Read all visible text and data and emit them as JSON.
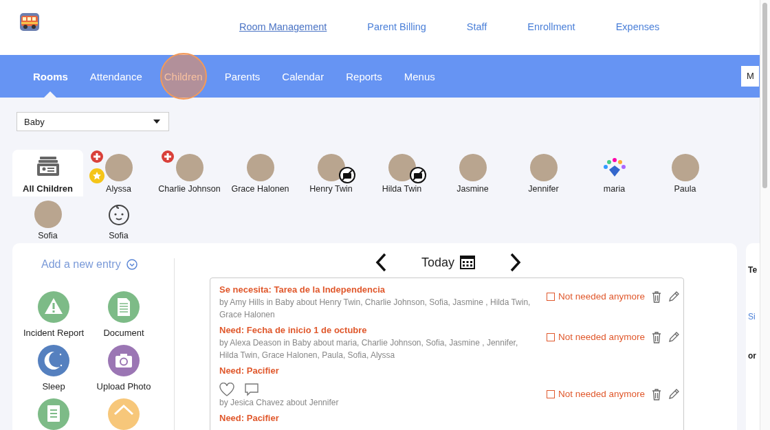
{
  "top_links": [
    {
      "label": "Room Management",
      "selected": true
    },
    {
      "label": "Parent Billing",
      "selected": false
    },
    {
      "label": "Staff",
      "selected": false
    },
    {
      "label": "Enrollment",
      "selected": false
    },
    {
      "label": "Expenses",
      "selected": false
    }
  ],
  "tabs": [
    {
      "label": "Rooms",
      "selected": true,
      "highlighted": false
    },
    {
      "label": "Attendance",
      "selected": false,
      "highlighted": false
    },
    {
      "label": "Children",
      "selected": false,
      "highlighted": true
    },
    {
      "label": "Parents",
      "selected": false,
      "highlighted": false
    },
    {
      "label": "Calendar",
      "selected": false,
      "highlighted": false
    },
    {
      "label": "Reports",
      "selected": false,
      "highlighted": false
    },
    {
      "label": "Menus",
      "selected": false,
      "highlighted": false
    }
  ],
  "nav_corner": "M",
  "room_select": {
    "value": "Baby"
  },
  "children": [
    {
      "name": "All Children",
      "kind": "all",
      "selected": true,
      "medical_alert": false,
      "starred": false,
      "no_photo_permission": false
    },
    {
      "name": "Alyssa",
      "kind": "photo",
      "selected": false,
      "medical_alert": true,
      "starred": true,
      "no_photo_permission": false
    },
    {
      "name": "Charlie Johnson",
      "kind": "photo",
      "selected": false,
      "medical_alert": true,
      "starred": false,
      "no_photo_permission": false
    },
    {
      "name": "Grace Halonen",
      "kind": "photo",
      "selected": false,
      "medical_alert": false,
      "starred": false,
      "no_photo_permission": false
    },
    {
      "name": "Henry Twin",
      "kind": "photo",
      "selected": false,
      "medical_alert": false,
      "starred": false,
      "no_photo_permission": true
    },
    {
      "name": "Hilda Twin",
      "kind": "photo",
      "selected": false,
      "medical_alert": false,
      "starred": false,
      "no_photo_permission": true
    },
    {
      "name": "Jasmine",
      "kind": "photo",
      "selected": false,
      "medical_alert": false,
      "starred": false,
      "no_photo_permission": false
    },
    {
      "name": "Jennifer",
      "kind": "photo",
      "selected": false,
      "medical_alert": false,
      "starred": false,
      "no_photo_permission": false
    },
    {
      "name": "maria",
      "kind": "logo",
      "selected": false,
      "medical_alert": false,
      "starred": false,
      "no_photo_permission": false
    },
    {
      "name": "Paula",
      "kind": "photo",
      "selected": false,
      "medical_alert": false,
      "starred": false,
      "no_photo_permission": false
    },
    {
      "name": "Sofia",
      "kind": "photo",
      "selected": false,
      "medical_alert": false,
      "starred": false,
      "no_photo_permission": false
    },
    {
      "name": "Sofia",
      "kind": "face",
      "selected": false,
      "medical_alert": false,
      "starred": false,
      "no_photo_permission": false
    }
  ],
  "add_entry": {
    "label": "Add a new entry"
  },
  "entry_types": [
    {
      "label": "Incident Report",
      "kind": "warning",
      "color": "#7dbb87"
    },
    {
      "label": "Document",
      "kind": "document",
      "color": "#7dbb87"
    },
    {
      "label": "Sleep",
      "kind": "moon",
      "color": "#5580bf"
    },
    {
      "label": "Upload Photo",
      "kind": "camera",
      "color": "#9b76b4"
    },
    {
      "kind": "checklist",
      "color": "#7dbb87"
    },
    {
      "kind": "house",
      "color": "#f7c77a"
    }
  ],
  "date_nav": {
    "label": "Today"
  },
  "entries": [
    {
      "title": "Se necesita: Tarea de la Independencia",
      "meta": "by Amy Hills in Baby about Henry Twin, Charlie Johnson, Sofia, Jasmine , Hilda Twin, Grace Halonen",
      "action": "Not needed anymore",
      "checked": false,
      "reactions": false
    },
    {
      "title": "Need: Fecha de inicio 1 de octubre",
      "meta": "by Alexa Deason in Baby about maria, Charlie Johnson, Sofia, Jasmine , Jennifer, Hilda Twin, Grace Halonen, Paula, Sofia, Alyssa",
      "action": "Not needed anymore",
      "checked": false,
      "reactions": false
    },
    {
      "title": "Need: Pacifier",
      "meta": "by Jesica Chavez about Jennifer",
      "action": "Not needed anymore",
      "checked": false,
      "reactions": true
    },
    {
      "title": "Need: Pacifier"
    }
  ],
  "side_panel": [
    "Te",
    "Si",
    "or"
  ]
}
